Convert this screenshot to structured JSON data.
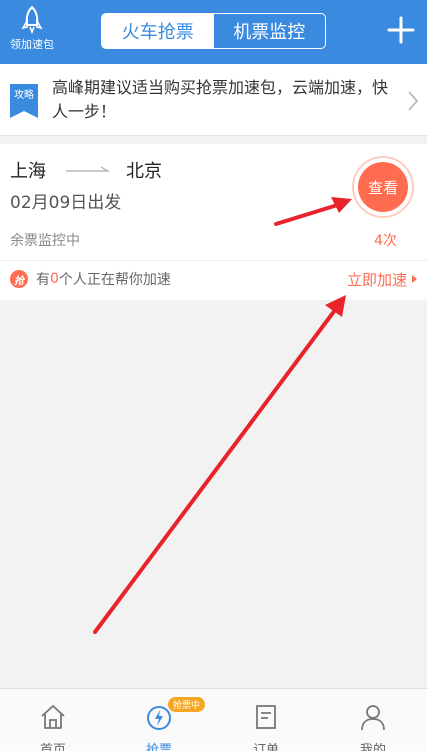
{
  "header": {
    "speedup_pack_label": "领加速包",
    "tabs": [
      {
        "label": "火车抢票",
        "active": true
      },
      {
        "label": "机票监控",
        "active": false
      }
    ],
    "accent_color": "#3a8ae0"
  },
  "tip": {
    "badge_text": "攻略",
    "message": "高峰期建议适当购买抢票加速包，云端加速，快人一步！"
  },
  "order": {
    "from": "上海",
    "to": "北京",
    "departure": "02月09日出发",
    "status": "余票监控中",
    "view_label": "查看",
    "count": "4次",
    "helper_icon_text": "抢",
    "helper_prefix": "有",
    "helper_count": "0",
    "helper_suffix": "个人正在帮你加速",
    "speedup_label": "立即加速",
    "highlight_color": "#ff6c50"
  },
  "tabbar": {
    "items": [
      {
        "label": "首页",
        "icon": "home-icon"
      },
      {
        "label": "抢票",
        "icon": "speedometer-icon",
        "tag": "抢票中",
        "active": true
      },
      {
        "label": "订单",
        "icon": "order-icon"
      },
      {
        "label": "我的",
        "icon": "person-icon"
      }
    ]
  }
}
